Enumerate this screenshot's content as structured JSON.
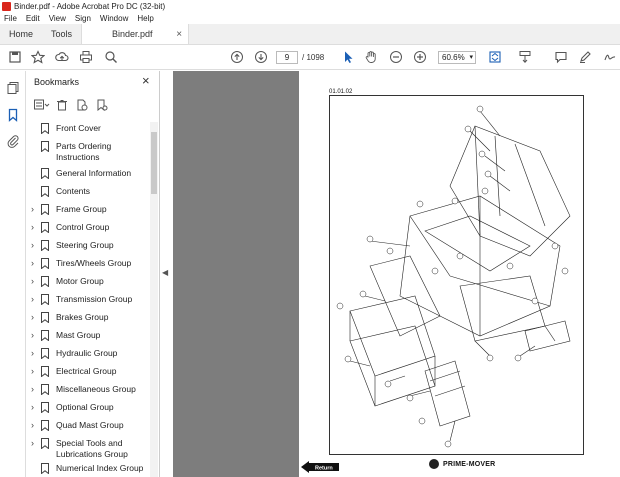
{
  "window": {
    "title": "Binder.pdf - Adobe Acrobat Pro DC (32-bit)"
  },
  "menu": [
    "File",
    "Edit",
    "View",
    "Sign",
    "Window",
    "Help"
  ],
  "tabs": {
    "home": "Home",
    "tools": "Tools",
    "document": "Binder.pdf"
  },
  "toolbar": {
    "current_page": "9",
    "page_total": "/ 1098",
    "zoom": "60.6%"
  },
  "bookmarks": {
    "title": "Bookmarks",
    "items": [
      {
        "label": "Front Cover",
        "expandable": false
      },
      {
        "label": "Parts Ordering Instructions",
        "expandable": false
      },
      {
        "label": "General Information",
        "expandable": false
      },
      {
        "label": "Contents",
        "expandable": false
      },
      {
        "label": "Frame Group",
        "expandable": true
      },
      {
        "label": "Control Group",
        "expandable": true
      },
      {
        "label": "Steering Group",
        "expandable": true
      },
      {
        "label": "Tires/Wheels Group",
        "expandable": true
      },
      {
        "label": "Motor Group",
        "expandable": true
      },
      {
        "label": "Transmission Group",
        "expandable": true
      },
      {
        "label": "Brakes Group",
        "expandable": true
      },
      {
        "label": "Mast Group",
        "expandable": true
      },
      {
        "label": "Hydraulic Group",
        "expandable": true
      },
      {
        "label": "Electrical Group",
        "expandable": true
      },
      {
        "label": "Miscellaneous Group",
        "expandable": true
      },
      {
        "label": "Optional Group",
        "expandable": true
      },
      {
        "label": "Quad Mast Group",
        "expandable": true
      },
      {
        "label": "Special Tools and Lubrications Group",
        "expandable": true
      },
      {
        "label": "Numerical Index Group",
        "expandable": false
      }
    ]
  },
  "document": {
    "section_number": "01.01.02",
    "return_label": "Return",
    "brand": "PRIME-MOVER"
  }
}
